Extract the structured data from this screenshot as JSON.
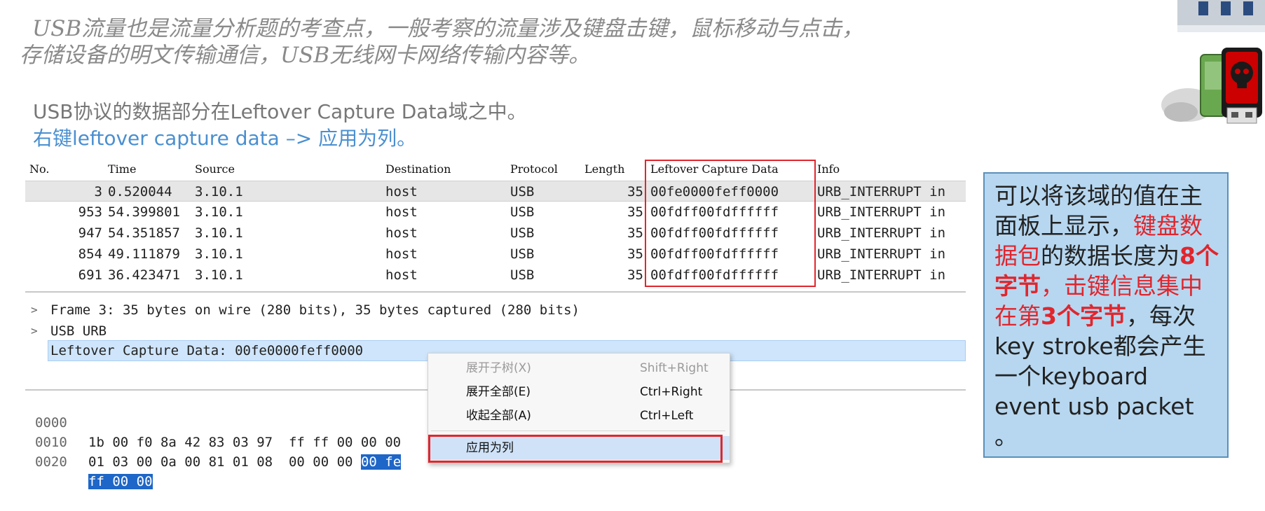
{
  "intro": {
    "line1": "USB流量也是流量分析题的考查点，一般考察的流量涉及键盘击键，鼠标移动与点击，",
    "line2": "存储设备的明文传输通信，USB无线网卡网络传输内容等。"
  },
  "subtitle": {
    "line1": "USB协议的数据部分在Leftover Capture Data域之中。",
    "line2": "右键leftover capture data –> 应用为列。"
  },
  "packet_list": {
    "columns": [
      "No.",
      "Time",
      "Source",
      "Destination",
      "Protocol",
      "Length",
      "Leftover Capture Data",
      "Info"
    ],
    "rows": [
      {
        "no": "3",
        "time": "0.520044",
        "source": "3.10.1",
        "destination": "host",
        "protocol": "USB",
        "length": "35",
        "leftover": "00fe0000feff0000",
        "info": "URB_INTERRUPT in"
      },
      {
        "no": "953",
        "time": "54.399801",
        "source": "3.10.1",
        "destination": "host",
        "protocol": "USB",
        "length": "35",
        "leftover": "00fdff00fdffffff",
        "info": "URB_INTERRUPT in"
      },
      {
        "no": "947",
        "time": "54.351857",
        "source": "3.10.1",
        "destination": "host",
        "protocol": "USB",
        "length": "35",
        "leftover": "00fdff00fdffffff",
        "info": "URB_INTERRUPT in"
      },
      {
        "no": "854",
        "time": "49.111879",
        "source": "3.10.1",
        "destination": "host",
        "protocol": "USB",
        "length": "35",
        "leftover": "00fdff00fdffffff",
        "info": "URB_INTERRUPT in"
      },
      {
        "no": "691",
        "time": "36.423471",
        "source": "3.10.1",
        "destination": "host",
        "protocol": "USB",
        "length": "35",
        "leftover": "00fdff00fdffffff",
        "info": "URB_INTERRUPT in"
      }
    ]
  },
  "details": {
    "frame": "Frame 3: 35 bytes on wire (280 bits), 35 bytes captured (280 bits)",
    "usb_urb": "USB URB",
    "leftover": "Leftover Capture Data: 00fe0000feff0000"
  },
  "bytes": {
    "rows": [
      {
        "offset": "0000",
        "hex": "1b 00 f0 8a 42 83 03 97  ff ff 00 00 00",
        "hex_hl": ""
      },
      {
        "offset": "0010",
        "hex": "01 03 00 0a 00 81 01 08  00 00 00 ",
        "hex_hl": "00 fe"
      },
      {
        "offset": "0020",
        "hex": "",
        "hex_hl": "ff 00 00"
      }
    ]
  },
  "context_menu": {
    "items": [
      {
        "label": "展开子树(X)",
        "shortcut": "Shift+Right",
        "disabled": true
      },
      {
        "label": "展开全部(E)",
        "shortcut": "Ctrl+Right",
        "disabled": false
      },
      {
        "label": "收起全部(A)",
        "shortcut": "Ctrl+Left",
        "disabled": false
      }
    ],
    "apply": "应用为列"
  },
  "note": {
    "p1": "可以将该域的值在主面板上显示，",
    "p2": "键盘数据包",
    "p3": "的数据长度为",
    "p4": "8个字节",
    "p5": "，",
    "p6": "击键信息集中在第",
    "p7": "3个字节",
    "p8": "，每次key stroke都会产生一个keyboard event usb packet 。"
  },
  "colors": {
    "highlight_red": "#e0262d",
    "note_bg": "#b7d7f0",
    "selection_blue": "#1e66c8",
    "link_blue": "#4a8fd0"
  }
}
